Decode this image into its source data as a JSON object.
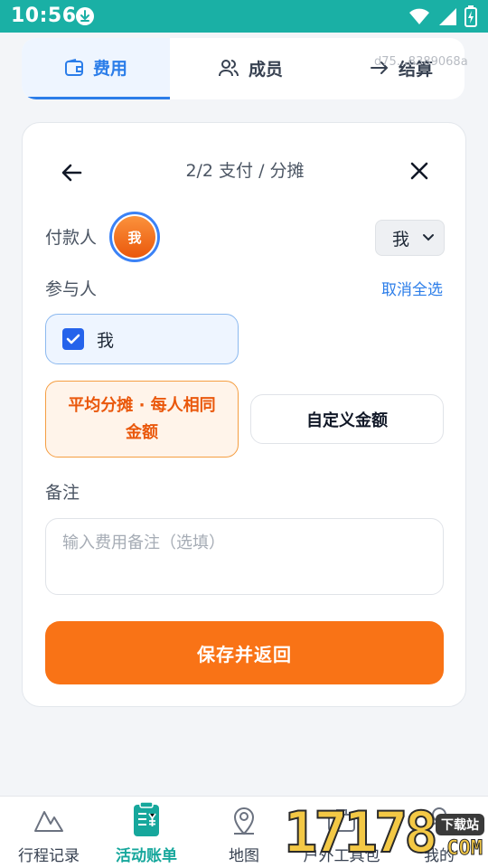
{
  "status_bar": {
    "time": "10:56"
  },
  "tabs": [
    {
      "label": "费用",
      "icon": "wallet-icon",
      "active": true
    },
    {
      "label": "成员",
      "icon": "users-icon",
      "active": false
    },
    {
      "label": "结算",
      "icon": "arrow-right-icon",
      "active": false
    }
  ],
  "watermark": "d75…8389068a",
  "card": {
    "step_title": "2/2 支付 / 分摊",
    "payer_label": "付款人",
    "payer_avatar_text": "我",
    "payer_select_value": "我",
    "participants_label": "参与人",
    "deselect_all": "取消全选",
    "participants": [
      {
        "name": "我",
        "checked": true
      }
    ],
    "split_modes": {
      "equal": "平均分摊 · 每人相同金额",
      "custom": "自定义金额",
      "selected": "equal"
    },
    "notes_label": "备注",
    "notes_placeholder": "输入费用备注（选填）",
    "save_button": "保存并返回"
  },
  "bottom_nav": [
    {
      "label": "行程记录",
      "icon": "mountain-icon",
      "active": false
    },
    {
      "label": "活动账单",
      "icon": "bill-icon",
      "active": true
    },
    {
      "label": "地图",
      "icon": "map-pin-icon",
      "active": false
    },
    {
      "label": "户外工具包",
      "icon": "toolbox-icon",
      "active": false
    },
    {
      "label": "我的",
      "icon": "user-icon",
      "active": false
    }
  ],
  "site_logo": {
    "number": "17178",
    "tag": "下载站",
    "suffix": "COM"
  },
  "colors": {
    "status_bar": "#1ab0a5",
    "accent_blue": "#2b7de9",
    "accent_orange": "#f97316",
    "nav_active": "#16a79c"
  }
}
